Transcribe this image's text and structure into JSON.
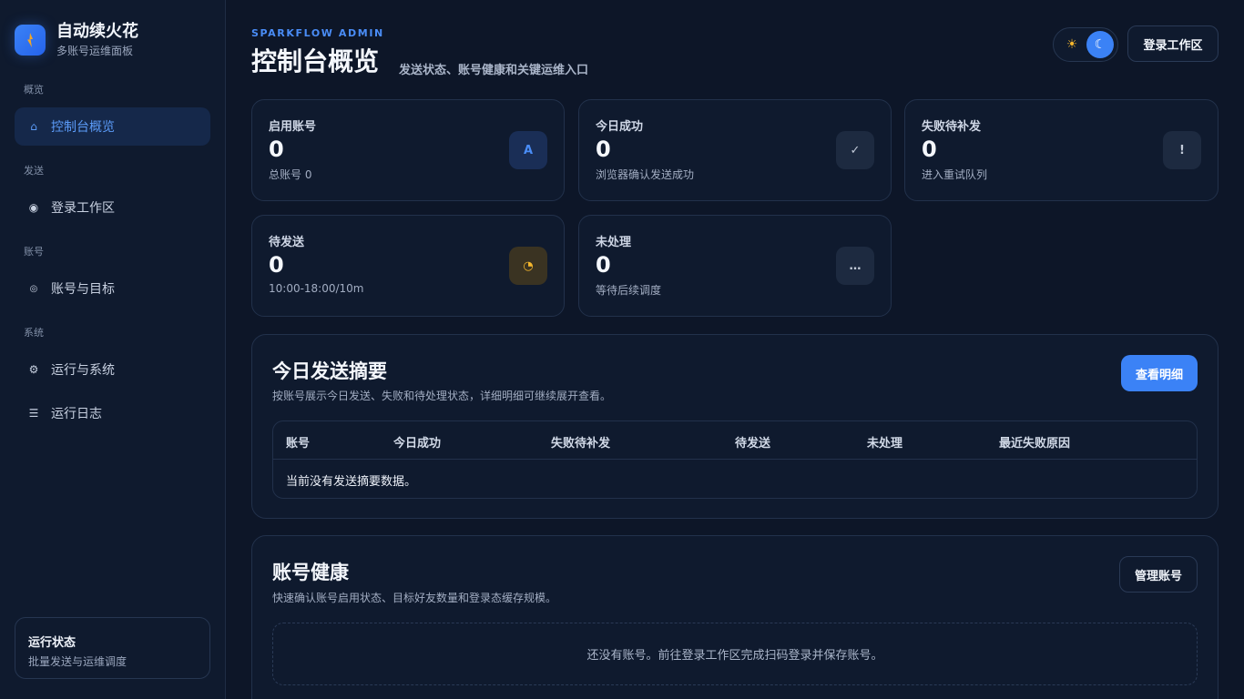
{
  "brand": {
    "title": "自动续火花",
    "subtitle": "多账号运维面板"
  },
  "sidebar": {
    "sections": [
      {
        "label": "概览",
        "items": [
          {
            "label": "控制台概览",
            "icon": "home-icon",
            "active": true
          }
        ]
      },
      {
        "label": "发送",
        "items": [
          {
            "label": "登录工作区",
            "icon": "radio-dot-icon"
          }
        ]
      },
      {
        "label": "账号",
        "items": [
          {
            "label": "账号与目标",
            "icon": "target-icon"
          }
        ]
      },
      {
        "label": "系统",
        "items": [
          {
            "label": "运行与系统",
            "icon": "gear-icon"
          },
          {
            "label": "运行日志",
            "icon": "list-icon"
          }
        ]
      }
    ],
    "status": {
      "title": "运行状态",
      "subtitle": "批量发送与运维调度"
    }
  },
  "header": {
    "eyebrow": "SPARKFLOW ADMIN",
    "title": "控制台概览",
    "description": "发送状态、账号健康和关键运维入口",
    "theme_toggle": {
      "sun": "☀",
      "moon": "☾",
      "mode": "dark"
    },
    "login_button": "登录工作区"
  },
  "stats": [
    {
      "label": "启用账号",
      "value": "0",
      "sub": "总账号 0",
      "icon": "A",
      "icon_name": "account-icon",
      "icon_color": "#4a8df7",
      "icon_bg": "#1a2e56"
    },
    {
      "label": "今日成功",
      "value": "0",
      "sub": "浏览器确认发送成功",
      "icon": "✓",
      "icon_name": "check-icon",
      "icon_color": "#c2cad8",
      "icon_bg": "#1d2a40"
    },
    {
      "label": "失败待补发",
      "value": "0",
      "sub": "进入重试队列",
      "icon": "!",
      "icon_name": "alert-icon",
      "icon_color": "#c2cad8",
      "icon_bg": "#1d2a40"
    },
    {
      "label": "待发送",
      "value": "0",
      "sub": "10:00-18:00/10m",
      "icon": "◔",
      "icon_name": "clock-icon",
      "icon_color": "#f5b72d",
      "icon_bg": "#3a3322"
    },
    {
      "label": "未处理",
      "value": "0",
      "sub": "等待后续调度",
      "icon": "…",
      "icon_name": "more-icon",
      "icon_color": "#c2cad8",
      "icon_bg": "#1d2a40"
    }
  ],
  "summary": {
    "title": "今日发送摘要",
    "description": "按账号展示今日发送、失败和待处理状态，详细明细可继续展开查看。",
    "button": "查看明细",
    "columns": [
      "账号",
      "今日成功",
      "失败待补发",
      "待发送",
      "未处理",
      "最近失败原因"
    ],
    "empty": "当前没有发送摘要数据。"
  },
  "health": {
    "title": "账号健康",
    "description": "快速确认账号启用状态、目标好友数量和登录态缓存规模。",
    "button": "管理账号",
    "empty": "还没有账号。前往登录工作区完成扫码登录并保存账号。"
  }
}
